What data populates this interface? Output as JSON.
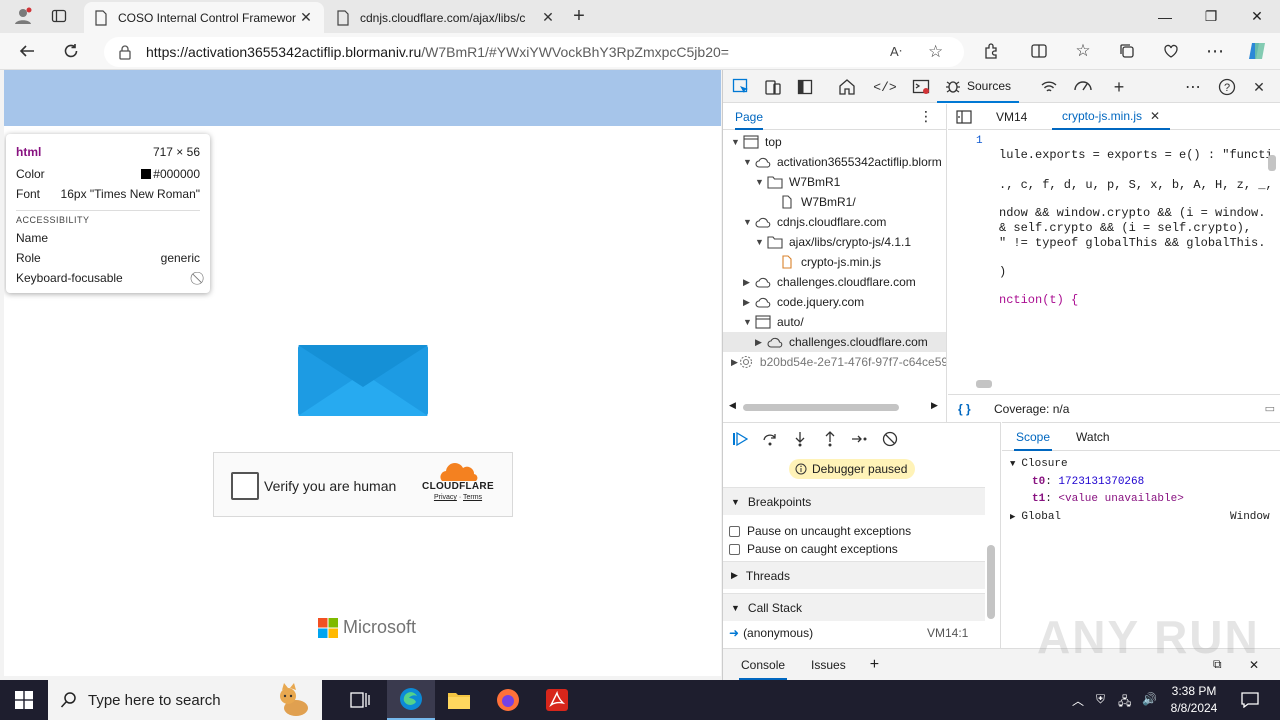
{
  "browser": {
    "tabs": [
      {
        "title": "COSO Internal Control Framewor",
        "active": true
      },
      {
        "title": "cdnjs.cloudflare.com/ajax/libs/c",
        "active": false
      }
    ],
    "url_host": "https://activation3655342actiflip.blormaniv.ru",
    "url_path": "/W7BmR1/#YWxiYWVockBhY3RpZmxpcC5jb20="
  },
  "page": {
    "inspect_tooltip": {
      "tag": "html",
      "size": "717 × 56",
      "color_label": "Color",
      "color_value": "#000000",
      "font_label": "Font",
      "font_value": "16px \"Times New Roman\"",
      "accessibility_heading": "ACCESSIBILITY",
      "name_label": "Name",
      "role_label": "Role",
      "role_value": "generic",
      "focusable_label": "Keyboard-focusable"
    },
    "captcha": {
      "label": "Verify you are human",
      "brand": "CLOUDFLARE",
      "privacy": "Privacy",
      "terms": "Terms"
    },
    "footer_brand": "Microsoft"
  },
  "devtools": {
    "active_panel": "Sources",
    "navigator": {
      "tab": "Page",
      "tree": [
        {
          "label": "top",
          "indent": 0,
          "expanded": true,
          "icon": "frame-icon"
        },
        {
          "label": "activation3655342actiflip.blorm",
          "indent": 1,
          "expanded": true,
          "icon": "cloud-icon"
        },
        {
          "label": "W7BmR1",
          "indent": 2,
          "expanded": true,
          "icon": "folder-icon"
        },
        {
          "label": "W7BmR1/",
          "indent": 3,
          "expanded": null,
          "icon": "file-icon"
        },
        {
          "label": "cdnjs.cloudflare.com",
          "indent": 1,
          "expanded": true,
          "icon": "cloud-icon"
        },
        {
          "label": "ajax/libs/crypto-js/4.1.1",
          "indent": 2,
          "expanded": true,
          "icon": "folder-icon"
        },
        {
          "label": "crypto-js.min.js",
          "indent": 3,
          "expanded": null,
          "icon": "js-file-icon"
        },
        {
          "label": "challenges.cloudflare.com",
          "indent": 1,
          "expanded": false,
          "icon": "cloud-icon"
        },
        {
          "label": "code.jquery.com",
          "indent": 1,
          "expanded": false,
          "icon": "cloud-icon"
        },
        {
          "label": "auto/",
          "indent": 1,
          "expanded": true,
          "icon": "frame-icon"
        },
        {
          "label": "challenges.cloudflare.com",
          "indent": 2,
          "expanded": false,
          "icon": "cloud-icon"
        },
        {
          "label": "b20bd54e-2e71-476f-97f7-c64ce59",
          "indent": 0,
          "expanded": false,
          "icon": "gear-icon"
        }
      ]
    },
    "editor": {
      "tabs": [
        "VM14",
        "crypto-js.min.js"
      ],
      "line_number": "1",
      "lines": [
        "lule.exports = exports = e() : \"functi",
        "., c, f, d, u, p, S, x, b, A, H, z, _,",
        "ndow && window.crypto && (i = window.",
        "& self.crypto && (i = self.crypto),",
        "\" != typeof globalThis && globalThis.",
        ")",
        "nction(t) {"
      ],
      "coverage": "Coverage: n/a"
    },
    "debugger": {
      "paused_label": "Debugger paused",
      "breakpoints": "Breakpoints",
      "pause_uncaught": "Pause on uncaught exceptions",
      "pause_caught": "Pause on caught exceptions",
      "threads": "Threads",
      "call_stack": "Call Stack",
      "frame_name": "(anonymous)",
      "frame_location": "VM14:1"
    },
    "scope": {
      "tabs": [
        "Scope",
        "Watch"
      ],
      "closure": "Closure",
      "t0_name": "t0",
      "t0_value": "1723131370268",
      "t1_name": "t1",
      "t1_value": "<value unavailable>",
      "global": "Global",
      "global_value": "Window"
    },
    "drawer_tabs": [
      "Console",
      "Issues"
    ]
  },
  "taskbar": {
    "search_placeholder": "Type here to search",
    "time": "3:38 PM",
    "date": "8/8/2024"
  },
  "watermark": "ANY RUN",
  "colors": {
    "accent": "#0078d4",
    "page_header": "#a6c5ea",
    "envelope": "#1d9be3",
    "cloudflare_orange": "#f48120"
  }
}
